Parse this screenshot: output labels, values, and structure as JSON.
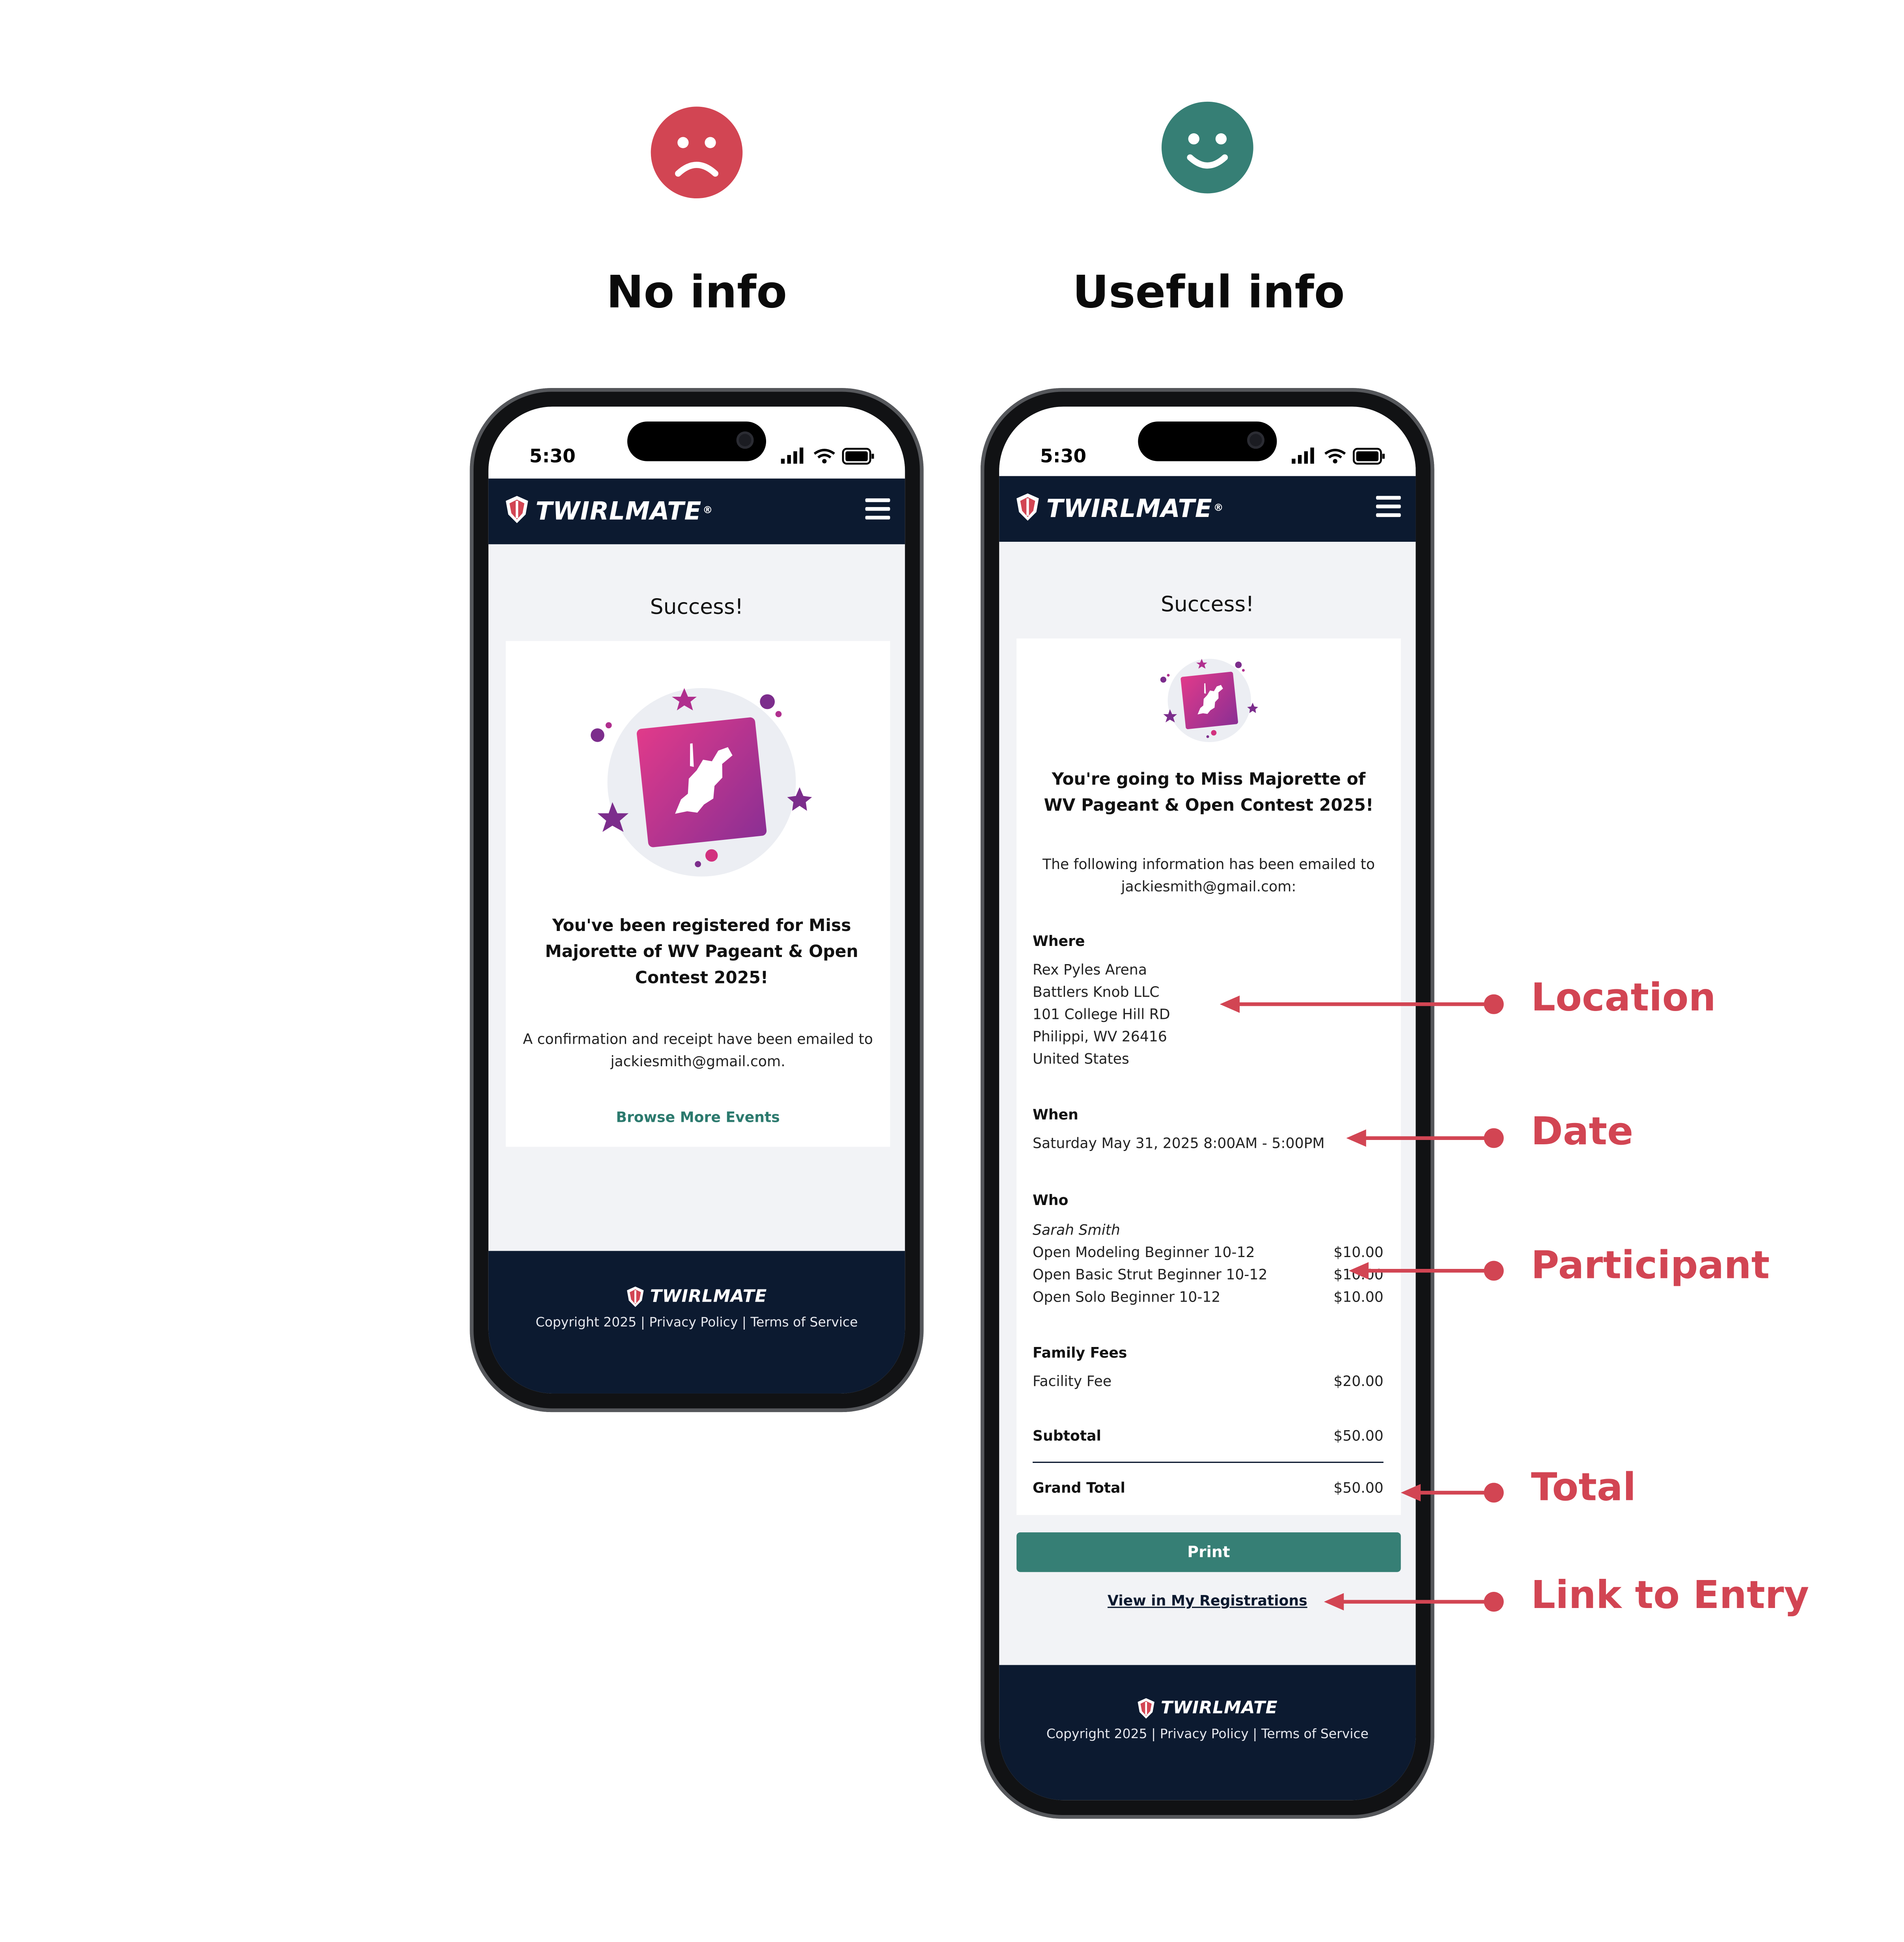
{
  "colors": {
    "accent_red": "#d24553",
    "accent_teal": "#367f75",
    "navy": "#0c1a30",
    "screen_bg": "#f2f3f6"
  },
  "icons": {
    "sad_face": "sad-face-icon",
    "happy_face": "happy-face-icon",
    "brand_logo": "twirlmate-shield-icon",
    "menu": "hamburger-menu-icon",
    "illustration": "west-virginia-badge-icon"
  },
  "headings": {
    "left": "No info",
    "right": "Useful info"
  },
  "status_bar": {
    "time": "5:30"
  },
  "brand": {
    "name": "TWIRLMATE",
    "reg": "®"
  },
  "footer": {
    "copyright": "Copyright 2025 | Privacy Policy | Terms of Service"
  },
  "left_phone": {
    "title": "Success!",
    "message": "You've been registered for Miss Majorette of WV Pageant & Open Contest 2025!",
    "confirmation": "A confirmation and receipt have been emailed to jackiesmith@gmail.com.",
    "browse_link": "Browse More Events"
  },
  "right_phone": {
    "title": "Success!",
    "message": "You're going to Miss Majorette of WV Pageant & Open Contest 2025!",
    "emailed": "The following information has been emailed to jackiesmith@gmail.com:",
    "where": {
      "label": "Where",
      "lines": [
        "Rex Pyles Arena",
        "Battlers Knob LLC",
        "101 College Hill RD",
        "Philippi, WV 26416",
        "United States"
      ]
    },
    "when": {
      "label": "When",
      "value": "Saturday May 31, 2025 8:00AM - 5:00PM"
    },
    "who": {
      "label": "Who",
      "participant": "Sarah Smith",
      "items": [
        {
          "name": "Open Modeling Beginner 10-12",
          "price": "$10.00"
        },
        {
          "name": "Open Basic Strut Beginner 10-12",
          "price": "$10.00"
        },
        {
          "name": "Open Solo Beginner 10-12",
          "price": "$10.00"
        }
      ]
    },
    "family_fees": {
      "label": "Family Fees",
      "items": [
        {
          "name": "Facility Fee",
          "price": "$20.00"
        }
      ]
    },
    "subtotal": {
      "label": "Subtotal",
      "value": "$50.00"
    },
    "grand_total": {
      "label": "Grand Total",
      "value": "$50.00"
    },
    "print_button": "Print",
    "registrations_link": "View in My Registrations"
  },
  "annotations": {
    "location": "Location",
    "date": "Date",
    "participant": "Participant",
    "total": "Total",
    "link": "Link to Entry"
  }
}
